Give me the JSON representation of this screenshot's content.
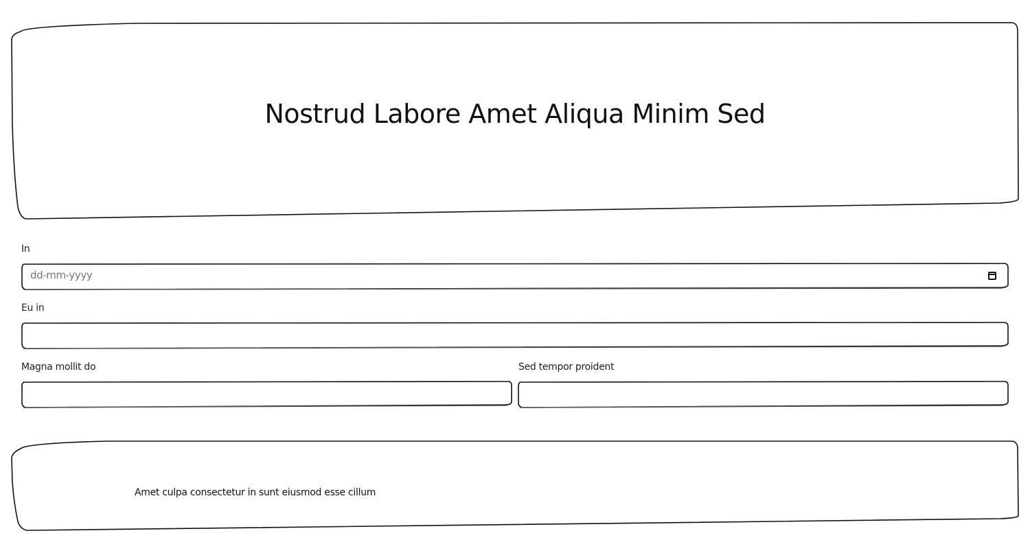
{
  "header": {
    "title": "Nostrud Labore Amet Aliqua Minim Sed"
  },
  "form": {
    "field_in": {
      "label": "In",
      "placeholder": "dd-mm-yyyy"
    },
    "field_eu_in": {
      "label": "Eu in",
      "value": ""
    },
    "field_magna": {
      "label": "Magna mollit do",
      "value": ""
    },
    "field_sed": {
      "label": "Sed tempor proident",
      "value": ""
    }
  },
  "footer": {
    "text": "Amet culpa consectetur in sunt eiusmod esse cillum"
  },
  "icons": {
    "date_picker": "calendar-icon"
  },
  "colors": {
    "stroke": "#111111",
    "background": "#ffffff"
  }
}
